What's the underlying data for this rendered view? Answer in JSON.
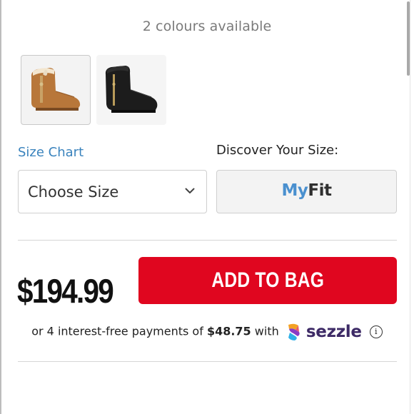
{
  "colours": {
    "available_text": "2 colours available"
  },
  "swatches": [
    {
      "name": "Chestnut",
      "color": "#b8773a",
      "selected": true
    },
    {
      "name": "Black",
      "color": "#1c1c1c",
      "selected": false
    }
  ],
  "size": {
    "chart_link": "Size Chart",
    "select_value": "Choose Size",
    "discover_label": "Discover Your Size:",
    "myfit_my": "My",
    "myfit_fit": "Fit"
  },
  "purchase": {
    "price": "$194.99",
    "add_to_bag": "ADD TO BAG",
    "brand_color": "#e0061f"
  },
  "financing": {
    "prefix": "or 4 interest-free payments of",
    "amount": "$48.75",
    "with": "with",
    "provider": "sezzle",
    "info_glyph": "i"
  }
}
